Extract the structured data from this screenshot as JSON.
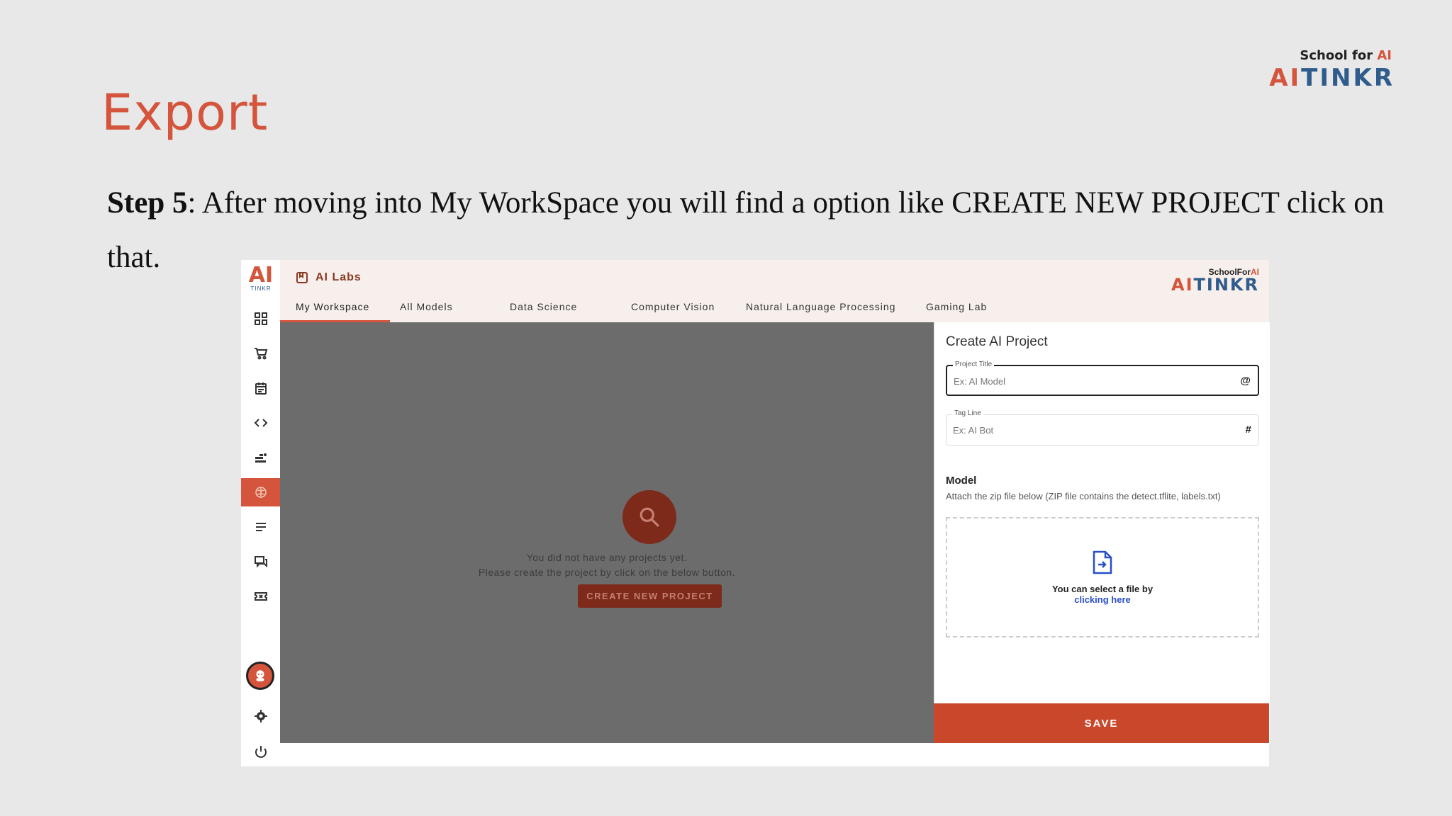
{
  "slide": {
    "title": "Export",
    "step_label": "Step 5",
    "step_text": ":  After moving into My WorkSpace you will find a option like CREATE NEW PROJECT click on that.",
    "brand_school": "School for",
    "brand_ai_symbol": "AI",
    "brand_ai": "AI",
    "brand_tinkr": "TINKR"
  },
  "app": {
    "title": "AI Labs",
    "brand_school": "SchoolFor",
    "brand_ai_symbol": "AI",
    "brand_ai": "AI",
    "brand_tinkr": "TINKR",
    "sidebar_logo_ai": "AI",
    "sidebar_logo_tinkr": "TINKR",
    "tabs": [
      {
        "label": "My Workspace",
        "active": true
      },
      {
        "label": "All Models"
      },
      {
        "label": "Data Science"
      },
      {
        "label": "Computer Vision"
      },
      {
        "label": "Natural Language Processing"
      },
      {
        "label": "Gaming Lab"
      }
    ],
    "sidebar_icons": [
      "dashboard-icon",
      "cart-icon",
      "calendar-icon",
      "code-icon",
      "tools-icon",
      "brain-icon",
      "list-icon",
      "chat-icon",
      "ticket-icon"
    ],
    "workspace": {
      "empty_line1": "You did not have any projects yet.",
      "empty_line2": "Please create the project by click on the below button.",
      "create_button": "CREATE NEW PROJECT"
    },
    "panel": {
      "title": "Create AI Project",
      "project_title_label": "Project Title",
      "project_title_placeholder": "Ex: AI Model",
      "tagline_label": "Tag Line",
      "tagline_placeholder": "Ex: AI Bot",
      "model_heading": "Model",
      "model_desc": "Attach the zip file below (ZIP file contains the detect.tflite, labels.txt)",
      "drop_line1": "You can select a file by",
      "drop_link": "clicking here",
      "save_button": "SAVE"
    }
  },
  "colors": {
    "accent": "#d4543c",
    "brand_blue": "#2f5c8c",
    "overlay": "#6c6c6c",
    "link": "#2a4fc7"
  }
}
